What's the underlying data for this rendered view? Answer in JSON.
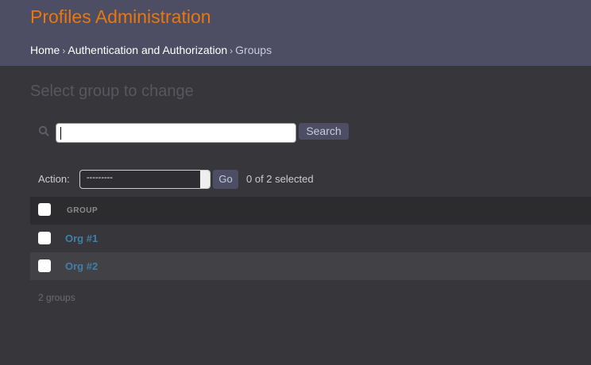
{
  "header": {
    "title": "Profiles Administration",
    "breadcrumbs": [
      "Home",
      "Authentication and Authorization",
      "Groups"
    ],
    "separator": "›"
  },
  "page_title": "Select group to change",
  "search": {
    "value": "",
    "button": "Search"
  },
  "actions": {
    "label": "Action:",
    "selected": "---------",
    "go": "Go",
    "counter": "0 of 2 selected"
  },
  "table": {
    "columns": [
      "GROUP"
    ],
    "rows": [
      {
        "name": "Org #1"
      },
      {
        "name": "Org #2"
      }
    ]
  },
  "paginator": "2 groups",
  "colors": {
    "header": "#4d4d63",
    "title": "#e8770e",
    "link": "#3f80a7"
  }
}
